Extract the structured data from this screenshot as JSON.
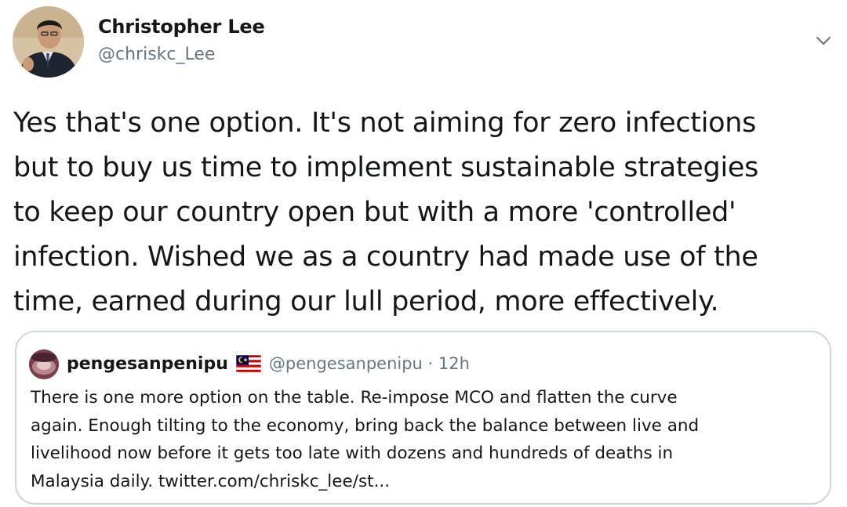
{
  "tweet": {
    "author_name": "Christopher Lee",
    "author_handle": "@chriskc_Lee",
    "avatar_icon": "profile-photo",
    "menu_icon": "chevron-down-icon",
    "text_lines": [
      "Yes that's one option. It's not aiming for zero infections",
      "but to buy us time to implement sustainable strategies",
      "to keep our country open but with a more 'controlled'",
      "infection. Wished we as a country had made use of the",
      "time, earned during our lull period, more effectively."
    ]
  },
  "quoted_tweet": {
    "author_name": "pengesanpenipu",
    "flag_icon": "malaysia-flag-icon",
    "handle_time": "@pengesanpenipu · 12h",
    "text_lines": [
      "There is one more option on the table. Re-impose MCO and flatten the curve",
      "again. Enough tilting to the economy, bring back the balance between live and",
      "livelihood now before it gets too late with dozens and hundreds of deaths in",
      "Malaysia daily. twitter.com/chriskc_lee/st..."
    ]
  },
  "colors": {
    "text": "#14171a",
    "secondary": "#657786",
    "border": "#ccd6dd"
  }
}
